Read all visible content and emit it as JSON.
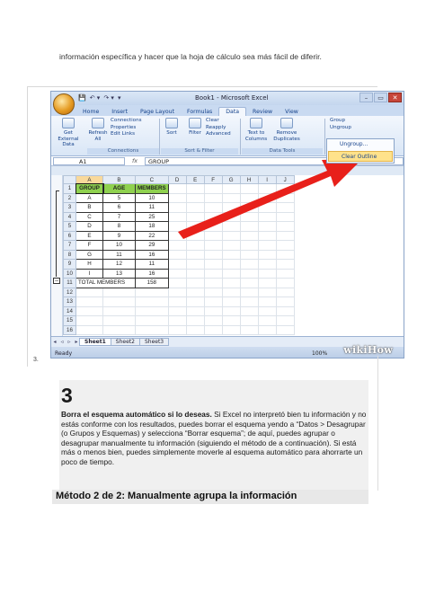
{
  "intro_text": "información específica y hacer que la hoja de cálculo sea más fácil de diferir.",
  "image_list_number": "3.",
  "excel": {
    "window_title": "Book1 - Microsoft Excel",
    "qat": [
      "💾",
      "↶ ▾",
      "↷ ▾",
      "▾"
    ],
    "window_buttons": [
      "–",
      "▭",
      "✕"
    ],
    "tabs": [
      "Home",
      "Insert",
      "Page Layout",
      "Formulas",
      "Data",
      "Review",
      "View"
    ],
    "active_tab": "Data",
    "ribbon": {
      "get_external": "Get External Data",
      "refresh": "Refresh All",
      "connections": [
        "Connections",
        "Properties",
        "Edit Links"
      ],
      "connections_label": "Connections",
      "sort": "Sort",
      "filter": "Filter",
      "clear": "Clear",
      "reapply": "Reapply",
      "advanced": "Advanced",
      "sort_filter_label": "Sort & Filter",
      "text_to_columns": "Text to Columns",
      "remove_duplicates": "Remove Duplicates",
      "data_tools_label": "Data Tools",
      "group": "Group",
      "ungroup": "Ungroup"
    },
    "dropdown_items": [
      "Ungroup...",
      "Clear Outline"
    ],
    "name_box": "A1",
    "fx": "fx",
    "formula_value": "GROUP",
    "columns": [
      "A",
      "B",
      "C",
      "D",
      "E",
      "F",
      "G",
      "H",
      "I",
      "J"
    ],
    "rows": [
      [
        "GROUP",
        "AGE",
        "MEMBERS"
      ],
      [
        "A",
        "5",
        "10"
      ],
      [
        "B",
        "6",
        "11"
      ],
      [
        "C",
        "7",
        "25"
      ],
      [
        "D",
        "8",
        "18"
      ],
      [
        "E",
        "9",
        "22"
      ],
      [
        "F",
        "10",
        "29"
      ],
      [
        "G",
        "11",
        "16"
      ],
      [
        "H",
        "12",
        "11"
      ],
      [
        "I",
        "13",
        "16"
      ],
      [
        "TOTAL MEMBERS",
        "",
        "158"
      ],
      [
        "",
        "",
        ""
      ],
      [
        "",
        "",
        ""
      ],
      [
        "",
        "",
        ""
      ],
      [
        "",
        "",
        ""
      ],
      [
        "",
        "",
        ""
      ]
    ],
    "sheet_tabs": [
      "Sheet1",
      "Sheet2",
      "Sheet3"
    ],
    "status": "Ready",
    "zoom": "100%",
    "watermark": "wikiHow"
  },
  "step": {
    "number": "3",
    "bold_lead": "Borra el esquema automático si lo deseas.",
    "body": " Si Excel no interpretó bien tu información y no estás conforme con los resultados, puedes borrar el esquema yendo a “Datos > Desagrupar (o Grupos y Esquemas) y selecciona “Borrar esquema”; de aquí, puedes agrupar o desagrupar manualmente tu información (siguiendo el método de a continuación). Si está más o menos bien, puedes simplemente moverle al esquema automático para ahorrarte un poco de tiempo."
  },
  "method_heading": "Método 2 de 2: Manualmente agrupa la información",
  "colors": {
    "highlight_green": "#8fd14f",
    "arrow_red": "#e8201a"
  }
}
